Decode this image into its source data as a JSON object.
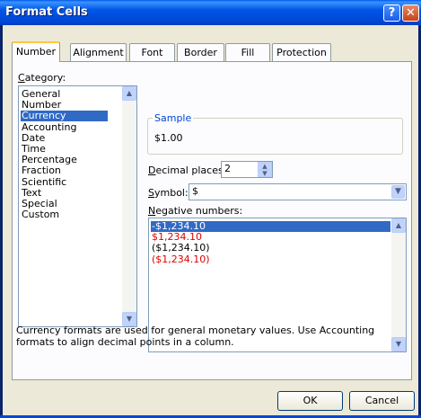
{
  "window": {
    "title": "Format Cells",
    "help_glyph": "?",
    "close_glyph": "✕"
  },
  "tabs": [
    {
      "label": "Number"
    },
    {
      "label": "Alignment"
    },
    {
      "label": "Font"
    },
    {
      "label": "Border"
    },
    {
      "label": "Fill"
    },
    {
      "label": "Protection"
    }
  ],
  "category": {
    "label": "Category:",
    "items": [
      "General",
      "Number",
      "Currency",
      "Accounting",
      "Date",
      "Time",
      "Percentage",
      "Fraction",
      "Scientific",
      "Text",
      "Special",
      "Custom"
    ],
    "selected": "Currency"
  },
  "sample": {
    "legend": "Sample",
    "value": "$1.00"
  },
  "decimal": {
    "label": "Decimal places:",
    "value": "2"
  },
  "symbol": {
    "label": "Symbol:",
    "value": "$"
  },
  "negative": {
    "label": "Negative numbers:",
    "items": [
      "-$1,234.10",
      "$1,234.10",
      "($1,234.10)",
      "($1,234.10)"
    ],
    "selected": "-$1,234.10",
    "red_items": [
      false,
      true,
      false,
      true
    ]
  },
  "description": "Currency formats are used for general monetary values.  Use Accounting formats to align decimal points in a column.",
  "buttons": {
    "ok": "OK",
    "cancel": "Cancel"
  },
  "colors": {
    "title_bar": "#0055e5",
    "selection": "#316ac5",
    "negative_red": "#e00000",
    "dialog_bg": "#ece9d8"
  }
}
